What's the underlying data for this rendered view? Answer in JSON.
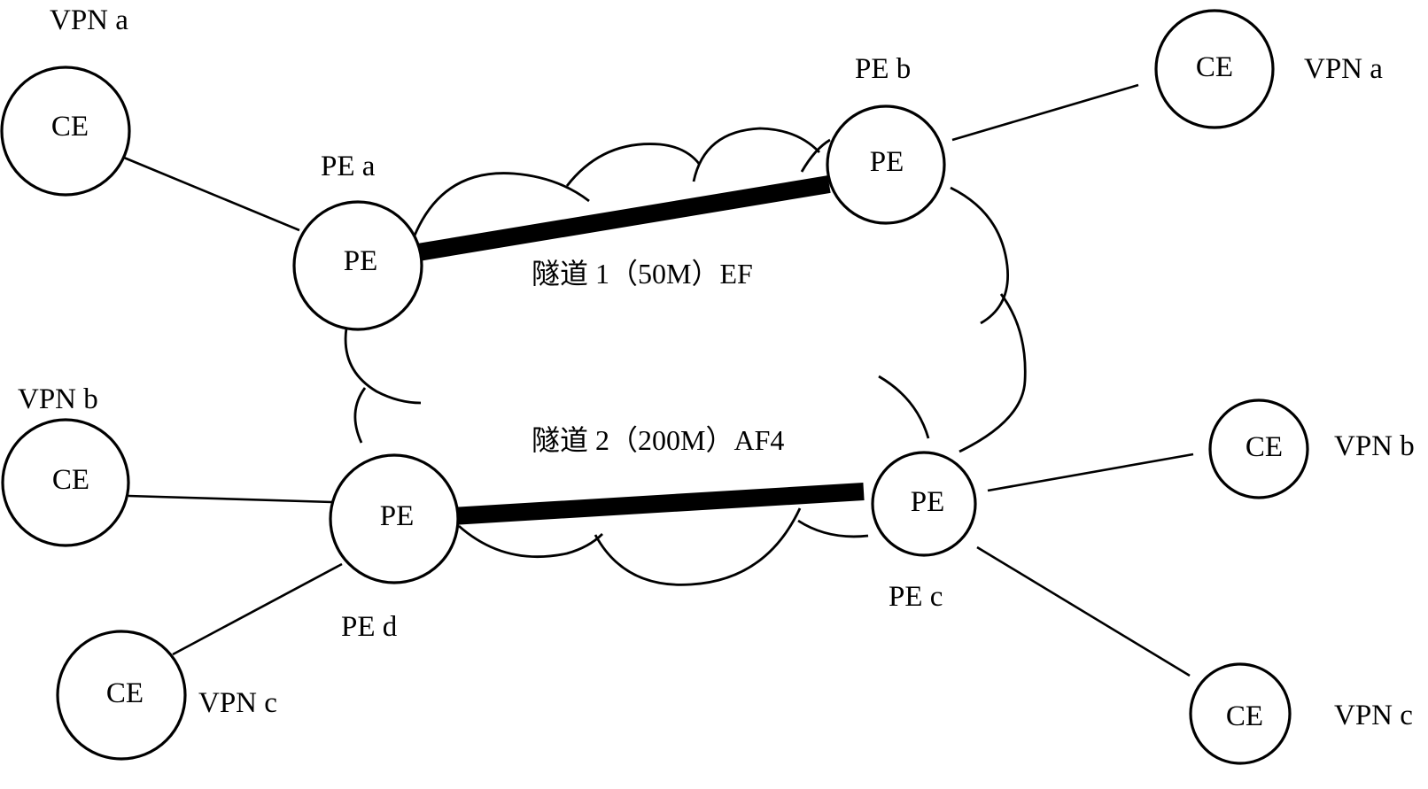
{
  "diagram": {
    "type": "vpn-network-topology",
    "colors": {
      "stroke": "#000000",
      "background": "#ffffff"
    },
    "nodes": {
      "ce_a_left": {
        "text": "CE",
        "vpn_label": "VPN a"
      },
      "ce_a_right": {
        "text": "CE",
        "vpn_label": "VPN a"
      },
      "ce_b_left": {
        "text": "CE",
        "vpn_label": "VPN b"
      },
      "ce_b_right": {
        "text": "CE",
        "vpn_label": "VPN b"
      },
      "ce_c_left": {
        "text": "CE",
        "vpn_label": "VPN c"
      },
      "ce_c_right": {
        "text": "CE",
        "vpn_label": "VPN c"
      },
      "pe_a": {
        "text": "PE",
        "name_label": "PE a"
      },
      "pe_b": {
        "text": "PE",
        "name_label": "PE b"
      },
      "pe_c": {
        "text": "PE",
        "name_label": "PE c"
      },
      "pe_d": {
        "text": "PE",
        "name_label": "PE d"
      }
    },
    "links": [
      {
        "from": "ce_a_left",
        "to": "pe_a"
      },
      {
        "from": "pe_b",
        "to": "ce_a_right"
      },
      {
        "from": "ce_b_left",
        "to": "pe_d"
      },
      {
        "from": "ce_c_left",
        "to": "pe_d"
      },
      {
        "from": "pe_c",
        "to": "ce_b_right"
      },
      {
        "from": "pe_c",
        "to": "ce_c_right"
      }
    ],
    "tunnels": [
      {
        "id": "tunnel_1",
        "from": "pe_a",
        "to": "pe_b",
        "label": "隧道 1（50M）EF",
        "bandwidth": "50M",
        "class": "EF"
      },
      {
        "id": "tunnel_2",
        "from": "pe_d",
        "to": "pe_c",
        "label": "隧道 2（200M）AF4",
        "bandwidth": "200M",
        "class": "AF4"
      }
    ],
    "cloud": {
      "meaning": "provider-network"
    }
  }
}
